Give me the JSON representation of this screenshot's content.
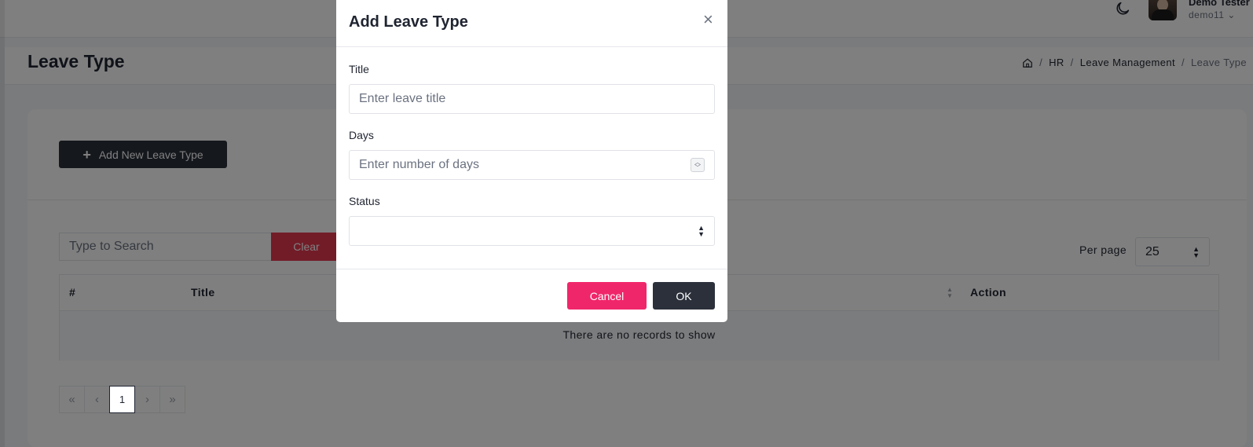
{
  "header": {
    "user_name": "Demo Tester",
    "user_id": "demo11",
    "user_chevron": "⌄"
  },
  "page": {
    "title": "Leave Type",
    "breadcrumb": [
      "HR",
      "Leave Management",
      "Leave Type"
    ]
  },
  "toolbar": {
    "add_label": "Add New Leave Type"
  },
  "search": {
    "placeholder": "Type to Search",
    "clear_label": "Clear"
  },
  "per_page": {
    "label": "Per page",
    "value": "25"
  },
  "table": {
    "columns": [
      "#",
      "Title",
      "Action"
    ],
    "empty_text": "There are no records to show"
  },
  "pagination": {
    "first": "«",
    "prev": "‹",
    "current": "1",
    "next": "›",
    "last": "»"
  },
  "modal": {
    "title": "Add Leave Type",
    "close": "×",
    "fields": {
      "title_label": "Title",
      "title_placeholder": "Enter leave title",
      "days_label": "Days",
      "days_placeholder": "Enter number of days",
      "status_label": "Status",
      "status_value": ""
    },
    "cancel_label": "Cancel",
    "ok_label": "OK"
  },
  "colors": {
    "primary_dark": "#2b303b",
    "danger": "#e53950",
    "cancel_pink": "#f0266b",
    "overlay": "rgba(0,0,0,0.5)"
  }
}
